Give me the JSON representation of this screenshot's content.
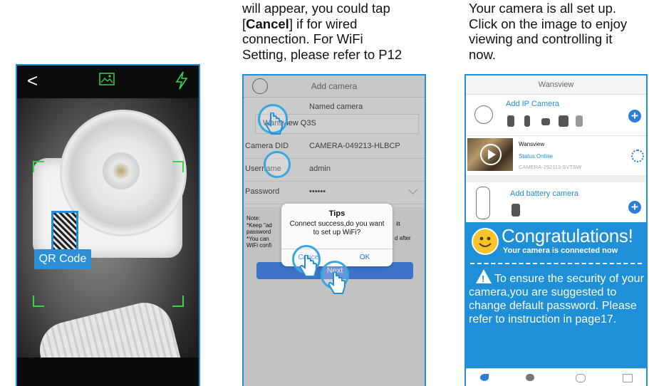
{
  "captions": {
    "middle": {
      "line1": "will appear, you could tap",
      "cancel_word": "Cancel",
      "line2_suffix": " if for wired",
      "line3": "connection. For WiFi",
      "line4": "Setting, please refer to P12"
    },
    "right": {
      "line1": "Your camera is all set up.",
      "line2": "Click on the image to enjoy",
      "line3": "viewing and controlling it",
      "line4": "now."
    }
  },
  "scan_screen": {
    "back_glyph": "<",
    "qr_label": "QR Code",
    "icons": [
      "back-icon",
      "image-icon",
      "flash-icon"
    ],
    "accent": "#3ad24a"
  },
  "add_camera_screen": {
    "title": "Add camera",
    "named_camera_label": "Named camera",
    "name_value": "Wansview Q3S",
    "fields": [
      {
        "label": "Camera DID",
        "value": "CAMERA-049213-HLBCP"
      },
      {
        "label": "Username",
        "value": "admin"
      },
      {
        "label": "Password",
        "value": "••••••"
      }
    ],
    "note": {
      "line1": "Note:",
      "line2": "*Keep \"ad",
      "line3": "password",
      "line4": "*You can",
      "line5": "WiFi confi",
      "right1": "ilt",
      "right2": "d after"
    },
    "dialog": {
      "title": "Tips",
      "message": "Connect success,do you want to set up WiFi?",
      "cancel": "Cancel",
      "ok": "OK"
    },
    "next_button": "Next"
  },
  "device_list_screen": {
    "title": "Wansview",
    "add_ip_camera": "Add IP Camera",
    "camera": {
      "name": "Wansview",
      "status": "Status:Online",
      "id": "CAMERA-292113-SVTBW"
    },
    "add_battery_camera": "Add battery camera",
    "promo": {
      "headline": "Congratulations!",
      "subline": "Your camera is connected now",
      "warning_lead": "To ensure the security",
      "warning_rest": "of your camera,you are suggested to change default password. Please refer to instruction in page17."
    },
    "tab_icons": [
      "home-icon",
      "chat-icon",
      "more-icon",
      "mail-icon"
    ],
    "brand_color": "#1f8fd6"
  }
}
